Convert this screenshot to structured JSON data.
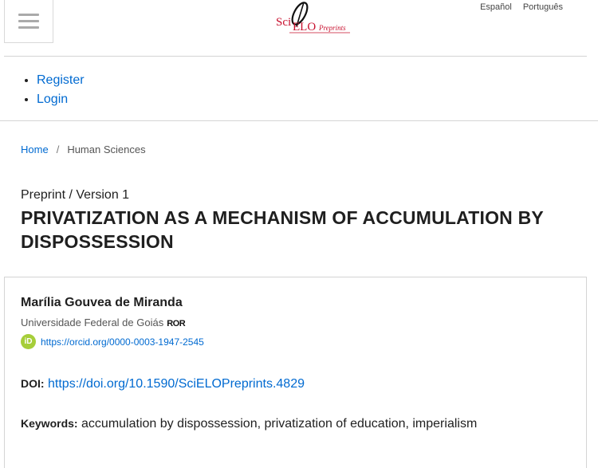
{
  "header": {
    "menu_icon": "hamburger-menu-icon",
    "logo": {
      "sci": "Sci",
      "elo": "ELO",
      "preprints": "Preprints"
    },
    "languages": [
      "Español",
      "Português"
    ]
  },
  "user_nav": {
    "register": "Register",
    "login": "Login"
  },
  "breadcrumb": {
    "home": "Home",
    "separator": "/",
    "current": "Human Sciences"
  },
  "article": {
    "version": "Preprint / Version 1",
    "title": "PRIVATIZATION AS A MECHANISM OF ACCUMULATION BY DISPOSSESSION",
    "author": {
      "name": "Marília Gouvea de Miranda",
      "affiliation": "Universidade Federal de Goiás",
      "ror_label": "ROR",
      "orcid_badge": "iD",
      "orcid_url": "https://orcid.org/0000-0003-1947-2545"
    },
    "doi_label": "DOI:",
    "doi": "https://doi.org/10.1590/SciELOPreprints.4829",
    "keywords_label": "Keywords:",
    "keywords": "accumulation by dispossession, privatization of education, imperialism"
  },
  "colors": {
    "link": "#006ad1",
    "orcid": "#a6ce39",
    "logo_red": "#c8102e"
  }
}
